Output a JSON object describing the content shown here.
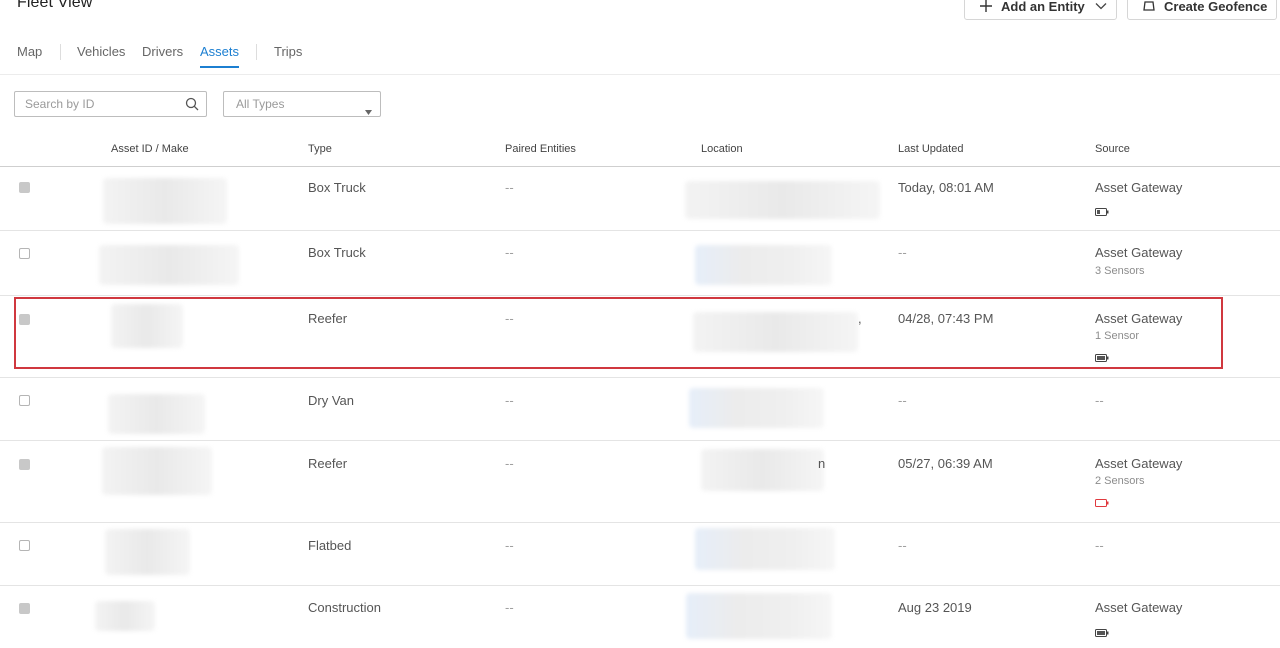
{
  "header": {
    "title": "Fleet View",
    "add_entity_label": "Add an Entity",
    "create_geofence_label": "Create Geofence"
  },
  "tabs": [
    {
      "label": "Map"
    },
    {
      "label": "Vehicles"
    },
    {
      "label": "Drivers"
    },
    {
      "label": "Assets",
      "active": true
    },
    {
      "label": "Trips"
    }
  ],
  "filters": {
    "search_placeholder": "Search by ID",
    "type_select_value": "All Types"
  },
  "table": {
    "columns": [
      "Asset ID / Make",
      "Type",
      "Paired Entities",
      "Location",
      "Last Updated",
      "Source"
    ],
    "rows": [
      {
        "type": "Box Truck",
        "paired": "--",
        "location_partial": "",
        "last_updated": "Today, 08:01 AM",
        "source": "Asset Gateway",
        "sensors": "",
        "battery": "low-gray"
      },
      {
        "type": "Box Truck",
        "paired": "--",
        "location_partial": "",
        "last_updated": "--",
        "source": "Asset Gateway",
        "sensors": "3 Sensors",
        "battery": ""
      },
      {
        "type": "Reefer",
        "paired": "--",
        "location_partial": ",",
        "last_updated": "04/28, 07:43 PM",
        "source": "Asset Gateway",
        "sensors": "1 Sensor",
        "battery": "full-gray"
      },
      {
        "type": "Dry Van",
        "paired": "--",
        "location_partial": "",
        "last_updated": "--",
        "source": "--",
        "sensors": "",
        "battery": ""
      },
      {
        "type": "Reefer",
        "paired": "--",
        "location_partial": "n",
        "last_updated": "05/27, 06:39 AM",
        "source": "Asset Gateway",
        "sensors": "2 Sensors",
        "battery": "empty-red"
      },
      {
        "type": "Flatbed",
        "paired": "--",
        "location_partial": "",
        "last_updated": "--",
        "source": "--",
        "sensors": "",
        "battery": ""
      },
      {
        "type": "Construction",
        "paired": "--",
        "location_partial": "",
        "last_updated": "Aug 23 2019",
        "source": "Asset Gateway",
        "sensors": "",
        "battery": "full-gray"
      }
    ]
  },
  "colors": {
    "accent": "#1c7fd1",
    "highlight_border": "#d0383f",
    "battery_low": "#e0393e"
  },
  "icons": {
    "add": "plus-icon",
    "dropdown": "chevron-down-icon",
    "geofence": "geofence-icon",
    "search": "search-icon",
    "select_arrow": "caret-down-icon",
    "battery": "battery-icon"
  }
}
